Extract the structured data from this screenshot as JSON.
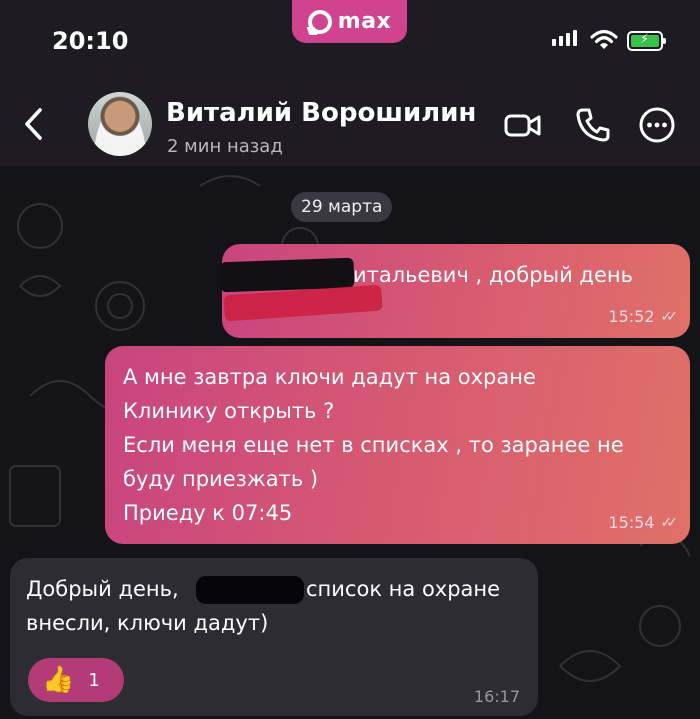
{
  "status_bar": {
    "time": "20:10",
    "app_brand": "max"
  },
  "header": {
    "contact_name": "Виталий Ворошилин",
    "contact_status": "2 мин назад",
    "icons": [
      "back-arrow-icon",
      "video-camera-icon",
      "phone-icon",
      "more-icon"
    ]
  },
  "chat": {
    "date_separator": "29 марта",
    "messages": [
      {
        "direction": "outgoing",
        "text": "Виталий Витальевич , добрый день",
        "time": "15:52",
        "status": "read"
      },
      {
        "direction": "outgoing",
        "lines": [
          "А мне завтра ключи дадут на охране",
          "Клинику открыть ?",
          "Если меня еще нет в списках , то заранее не",
          "буду приезжать )",
          "Приеду к 07:45"
        ],
        "time": "15:54",
        "status": "read"
      },
      {
        "direction": "incoming",
        "line1_start": "Добрый день,",
        "line1_end": "список на охране",
        "line2": "внесли, ключи дадут)",
        "time": "16:17",
        "reaction": {
          "emoji": "👍",
          "count": "1"
        }
      }
    ]
  },
  "colors": {
    "accent": "#d0448f",
    "outgoing_bubble": "#d85c70",
    "incoming_bubble": "#2e2c33",
    "background": "#141318"
  }
}
